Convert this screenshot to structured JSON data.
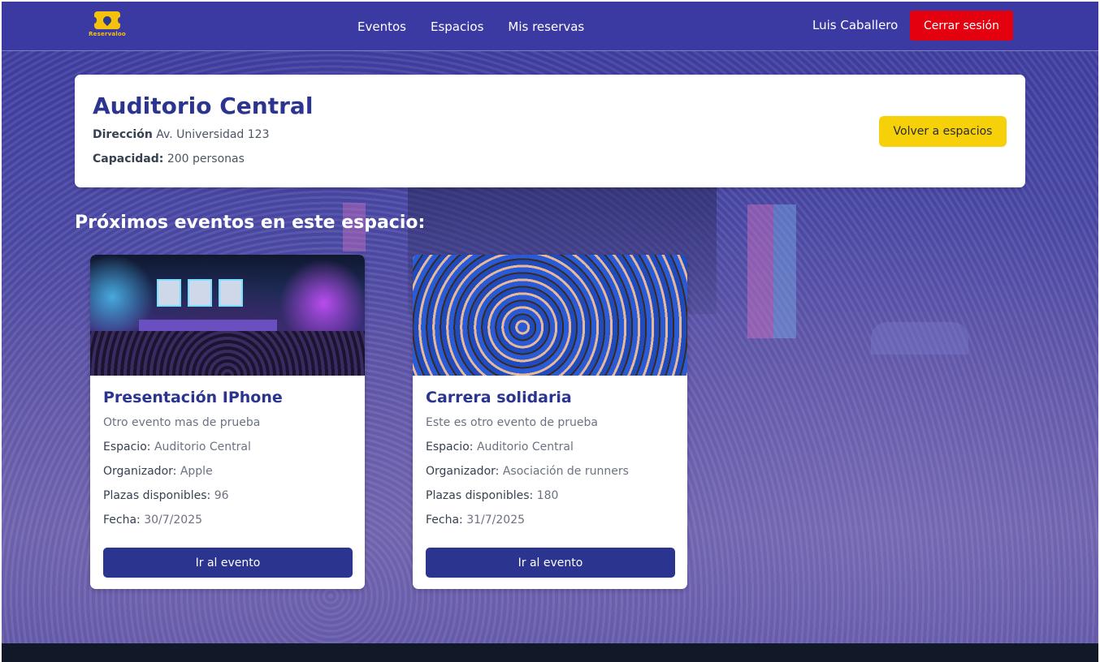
{
  "header": {
    "logo_text": "Reservaloo",
    "nav": [
      {
        "label": "Eventos"
      },
      {
        "label": "Espacios"
      },
      {
        "label": "Mis reservas"
      }
    ],
    "user_name": "Luis Caballero",
    "logout_label": "Cerrar sesión"
  },
  "venue": {
    "name": "Auditorio Central",
    "address_label": "Dirección",
    "address": "Av. Universidad 123",
    "capacity_label": "Capacidad:",
    "capacity": "200 personas",
    "back_label": "Volver a espacios"
  },
  "section_title": "Próximos eventos en este espacio:",
  "events": [
    {
      "title": "Presentación IPhone",
      "description": "Otro evento mas de prueba",
      "space_label": "Espacio:",
      "space": "Auditorio Central",
      "organizer_label": "Organizador:",
      "organizer": "Apple",
      "seats_label": "Plazas disponibles:",
      "seats": "96",
      "date_label": "Fecha:",
      "date": "30/7/2025",
      "button_label": "Ir al evento"
    },
    {
      "title": "Carrera solidaria",
      "description": "Este es otro evento de prueba",
      "space_label": "Espacio:",
      "space": "Auditorio Central",
      "organizer_label": "Organizador:",
      "organizer": "Asociación de runners",
      "seats_label": "Plazas disponibles:",
      "seats": "180",
      "date_label": "Fecha:",
      "date": "31/7/2025",
      "button_label": "Ir al evento"
    }
  ],
  "colors": {
    "header_bg": "#3b3aa3",
    "primary": "#2b3590",
    "logout": "#e3000f",
    "back_button": "#f6d10a",
    "footer": "#111827"
  }
}
